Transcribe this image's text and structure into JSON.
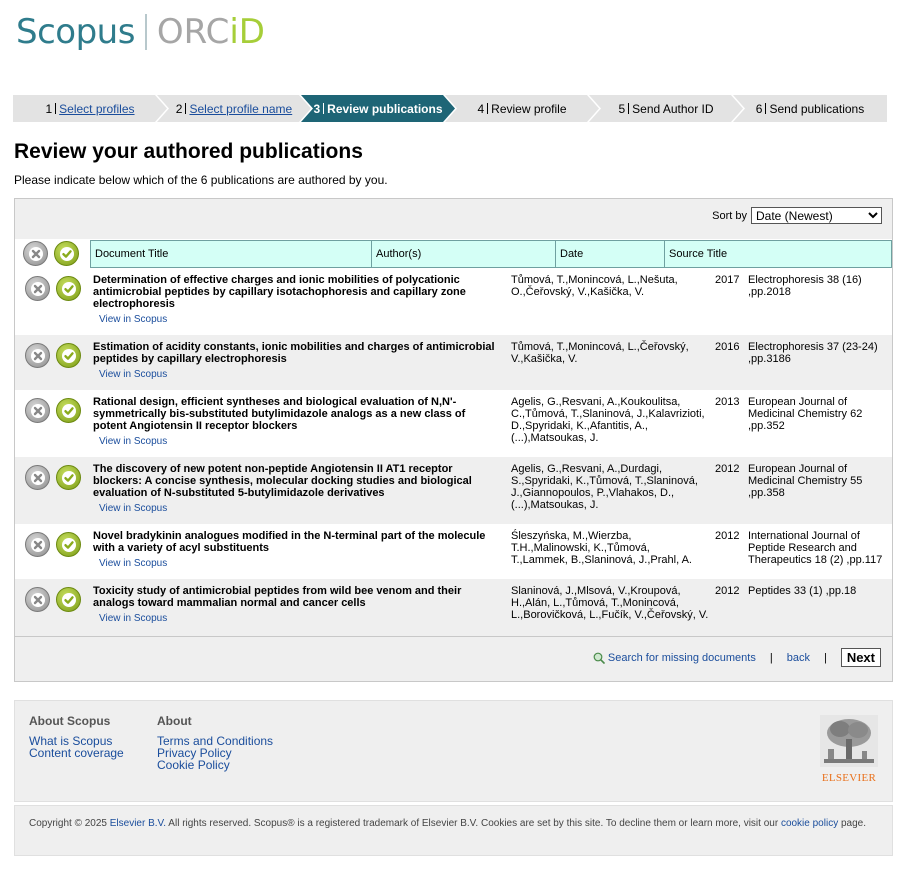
{
  "header": {
    "scopus_logo": "Scopus",
    "orcid_logo_prefix": "ORC",
    "orcid_logo_suffix": "iD"
  },
  "steps": [
    {
      "num": "1",
      "label": "Select profiles",
      "link": true
    },
    {
      "num": "2",
      "label": "Select profile name",
      "link": true
    },
    {
      "num": "3",
      "label": "Review publications",
      "active": true
    },
    {
      "num": "4",
      "label": "Review profile"
    },
    {
      "num": "5",
      "label": "Send Author ID"
    },
    {
      "num": "6",
      "label": "Send publications"
    }
  ],
  "page": {
    "title": "Review your authored publications",
    "intro": "Please indicate below which of the 6 publications are authored by you."
  },
  "sort": {
    "label": "Sort by",
    "selected": "Date (Newest)"
  },
  "table": {
    "headers": [
      "Document Title",
      "Author(s)",
      "Date",
      "Source Title"
    ],
    "view_label": "View in Scopus",
    "rows": [
      {
        "title": "Determination of effective charges and ionic mobilities of polycationic antimicrobial peptides by capillary isotachophoresis and capillary zone electrophoresis",
        "authors": "Tůmová, T.,Monincová, L.,Nešuta, O.,Čeřovský, V.,Kašička, V.",
        "date": "2017",
        "source": "Electrophoresis 38 (16) ,pp.2018"
      },
      {
        "title": "Estimation of acidity constants, ionic mobilities and charges of antimicrobial peptides by capillary electrophoresis",
        "authors": "Tůmová, T.,Monincová, L.,Čeřovský, V.,Kašička, V.",
        "date": "2016",
        "source": "Electrophoresis 37 (23-24) ,pp.3186"
      },
      {
        "title": "Rational design, efficient syntheses and biological evaluation of N,N'-symmetrically bis-substituted butylimidazole analogs as a new class of potent Angiotensin II receptor blockers",
        "authors": "Agelis, G.,Resvani, A.,Koukoulitsa, C.,Tůmová, T.,Slaninová, J.,Kalavrizioti, D.,Spyridaki, K.,Afantitis, A., (...),Matsoukas, J.",
        "date": "2013",
        "source": "European Journal of Medicinal Chemistry 62 ,pp.352"
      },
      {
        "title": "The discovery of new potent non-peptide Angiotensin II AT1 receptor blockers: A concise synthesis, molecular docking studies and biological evaluation of N-substituted 5-butylimidazole derivatives",
        "authors": "Agelis, G.,Resvani, A.,Durdagi, S.,Spyridaki, K.,Tůmová, T.,Slaninová, J.,Giannopoulos, P.,Vlahakos, D., (...),Matsoukas, J.",
        "date": "2012",
        "source": "European Journal of Medicinal Chemistry 55 ,pp.358"
      },
      {
        "title": "Novel bradykinin analogues modified in the N-terminal part of the molecule with a variety of acyl substituents",
        "authors": "Śleszyńska, M.,Wierzba, T.H.,Malinowski, K.,Tůmová, T.,Lammek, B.,Slaninová, J.,Prahl, A.",
        "date": "2012",
        "source": "International Journal of Peptide Research and Therapeutics 18 (2) ,pp.117"
      },
      {
        "title": "Toxicity study of antimicrobial peptides from wild bee venom and their analogs toward mammalian normal and cancer cells",
        "authors": "Slaninová, J.,Mlsová, V.,Kroupová, H.,Alán, L.,Tůmová, T.,Monincová, L.,Borovičková, L.,Fučík, V.,Čeřovský, V.",
        "date": "2012",
        "source": "Peptides 33 (1) ,pp.18"
      }
    ]
  },
  "actions": {
    "search_missing": "Search for missing documents",
    "back": "back",
    "next": "Next"
  },
  "footer": {
    "about_scopus": {
      "heading": "About Scopus",
      "links": [
        "What is Scopus",
        "Content coverage"
      ]
    },
    "about": {
      "heading": "About",
      "links": [
        "Terms and Conditions",
        "Privacy Policy",
        "Cookie Policy"
      ]
    },
    "elsevier_logo": "ELSEVIER",
    "copyright_pre": "Copyright © 2025 ",
    "copyright_link1": "Elsevier B.V.",
    "copyright_mid": " All rights reserved. Scopus® is a registered trademark of Elsevier B.V. Cookies are set by this site. To decline them or learn more, visit our ",
    "copyright_link2": "cookie policy",
    "copyright_post": " page."
  },
  "colors": {
    "teal_active": "#1e6576",
    "link": "#1a4d9c",
    "header_cell": "#d4fff6",
    "accept": "#8aab1c",
    "reject": "#9a9a9a",
    "elsevier_orange": "#e9711c"
  }
}
